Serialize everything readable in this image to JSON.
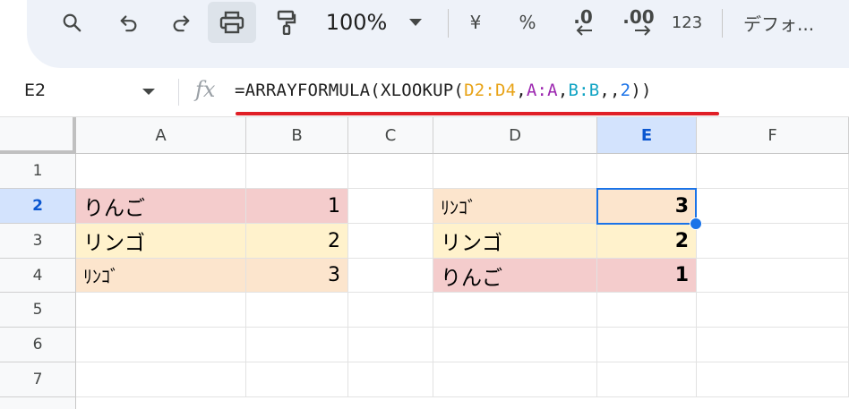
{
  "toolbar": {
    "zoom": "100%",
    "currency": "¥",
    "percent": "%",
    "dec_decrease": ".0",
    "dec_increase": ".00",
    "number_format": "123",
    "font": "デフォ..."
  },
  "formula_bar": {
    "cell_ref": "E2",
    "fx": "fx",
    "formula": {
      "fn_open": "=ARRAYFORMULA(XLOOKUP(",
      "arg1": "D2:D4",
      "comma1": ",",
      "arg2": "A:A",
      "comma2": ",",
      "arg3": "B:B",
      "commas": ",,",
      "arg4": "2",
      "close": "))"
    },
    "colors": {
      "arg1": "#e8a317",
      "arg2": "#9c27b0",
      "arg3": "#12a4c4",
      "arg4": "#1a73e8"
    }
  },
  "sheet": {
    "columns": [
      "A",
      "B",
      "C",
      "D",
      "E",
      "F"
    ],
    "rows": [
      "1",
      "2",
      "3",
      "4",
      "5",
      "6",
      "7"
    ],
    "cells": {
      "A2": "りんご",
      "B2": "1",
      "A3": "リンゴ",
      "B3": "2",
      "A4": "ﾘﾝｺﾞ",
      "B4": "3",
      "D2": "ﾘﾝｺﾞ",
      "E2": "3",
      "D3": "リンゴ",
      "E3": "2",
      "D4": "りんご",
      "E4": "1"
    },
    "selected_cell": "E2",
    "fill_colors": {
      "pink": "#f4cccc",
      "yellow": "#fff2cc",
      "orange": "#fce5cd"
    }
  }
}
